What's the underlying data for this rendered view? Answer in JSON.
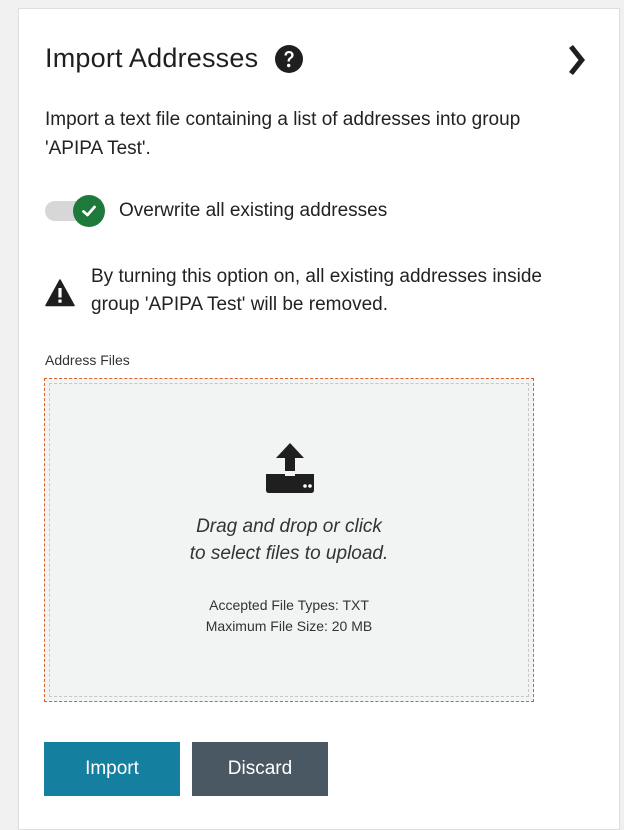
{
  "panel": {
    "title": "Import Addresses",
    "description": "Import a text file containing a list of addresses into group 'APIPA Test'."
  },
  "overwrite": {
    "label": "Overwrite all existing addresses",
    "checked": true
  },
  "warning": {
    "text": "By turning this option on, all existing addresses inside group 'APIPA Test' will be removed."
  },
  "address_files": {
    "label": "Address Files",
    "drop_line1": "Drag and drop or click",
    "drop_line2": "to select files to upload.",
    "accepted_types": "Accepted File Types: TXT",
    "max_size": "Maximum File Size: 20 MB"
  },
  "actions": {
    "import_label": "Import",
    "discard_label": "Discard"
  },
  "colors": {
    "toggle_on": "#1e7a3a",
    "import_button": "#147f9e",
    "discard_button": "#4a5864",
    "dropzone_border": "#d9622b"
  }
}
